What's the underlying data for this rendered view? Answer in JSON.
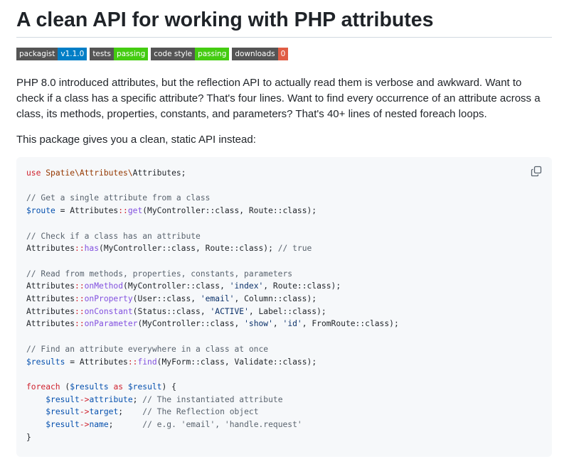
{
  "page": {
    "title": "A clean API for working with PHP attributes"
  },
  "badges": [
    {
      "label": "packagist",
      "value": "v1.1.0",
      "color": "#007ec6"
    },
    {
      "label": "tests",
      "value": "passing",
      "color": "#44cc11"
    },
    {
      "label": "code style",
      "value": "passing",
      "color": "#44cc11"
    },
    {
      "label": "downloads",
      "value": "0",
      "color": "#e05d44"
    }
  ],
  "paragraphs": {
    "intro": "PHP 8.0 introduced attributes, but the reflection API to actually read them is verbose and awkward. Want to check if a class has a specific attribute? That's four lines. Want to find every occurrence of an attribute across a class, its methods, properties, constants, and parameters? That's 40+ lines of nested foreach loops.",
    "lead": "This package gives you a clean, static API instead:"
  },
  "code_block": {
    "language": "php",
    "copy_icon": "copy-icon",
    "lines": [
      "use Spatie\\Attributes\\Attributes;",
      "",
      "// Get a single attribute from a class",
      "$route = Attributes::get(MyController::class, Route::class);",
      "",
      "// Check if a class has an attribute",
      "Attributes::has(MyController::class, Route::class); // true",
      "",
      "// Read from methods, properties, constants, parameters",
      "Attributes::onMethod(MyController::class, 'index', Route::class);",
      "Attributes::onProperty(User::class, 'email', Column::class);",
      "Attributes::onConstant(Status::class, 'ACTIVE', Label::class);",
      "Attributes::onParameter(MyController::class, 'show', 'id', FromRoute::class);",
      "",
      "// Find an attribute everywhere in a class at once",
      "$results = Attributes::find(MyForm::class, Validate::class);",
      "",
      "foreach ($results as $result) {",
      "    $result->attribute; // The instantiated attribute",
      "    $result->target;    // The Reflection object",
      "    $result->name;      // e.g. 'email', 'handle.request'",
      "}"
    ]
  }
}
